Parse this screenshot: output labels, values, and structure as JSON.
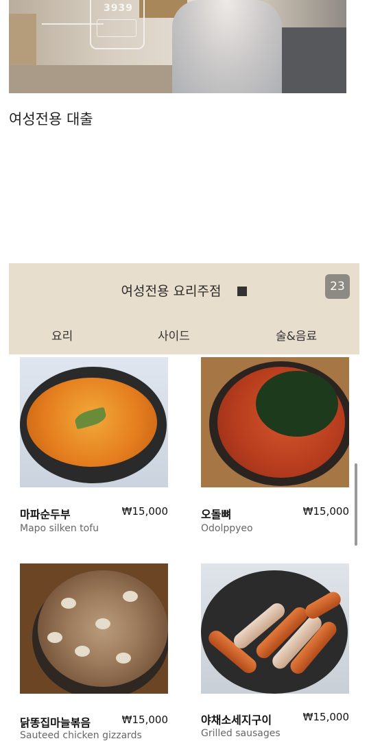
{
  "promo": {
    "phone_number": "3939",
    "title": "여성전용 대출"
  },
  "restaurant": {
    "title": "여성전용 요리주점",
    "badge": "23",
    "tabs": [
      "요리",
      "사이드",
      "술&음료"
    ]
  },
  "menu": [
    {
      "name_kr": "마파순두부",
      "name_en": "Mapo silken tofu",
      "price": "₩15,000",
      "image": "mapo-tofu-photo"
    },
    {
      "name_kr": "오돌뼈",
      "name_en": "Odolppyeo",
      "price": "₩15,000",
      "image": "odolppyeo-photo"
    },
    {
      "name_kr": "닭똥집마늘볶음",
      "name_en": "Sauteed chicken gizzards",
      "price": "₩15,000",
      "image": "chicken-gizzards-photo"
    },
    {
      "name_kr": "야채소세지구이",
      "name_en": "Grilled sausages",
      "price": "₩15,000",
      "image": "grilled-sausages-photo"
    }
  ],
  "colors": {
    "panel_bg": "#e8decd",
    "badge_bg": "#8d8a84"
  }
}
